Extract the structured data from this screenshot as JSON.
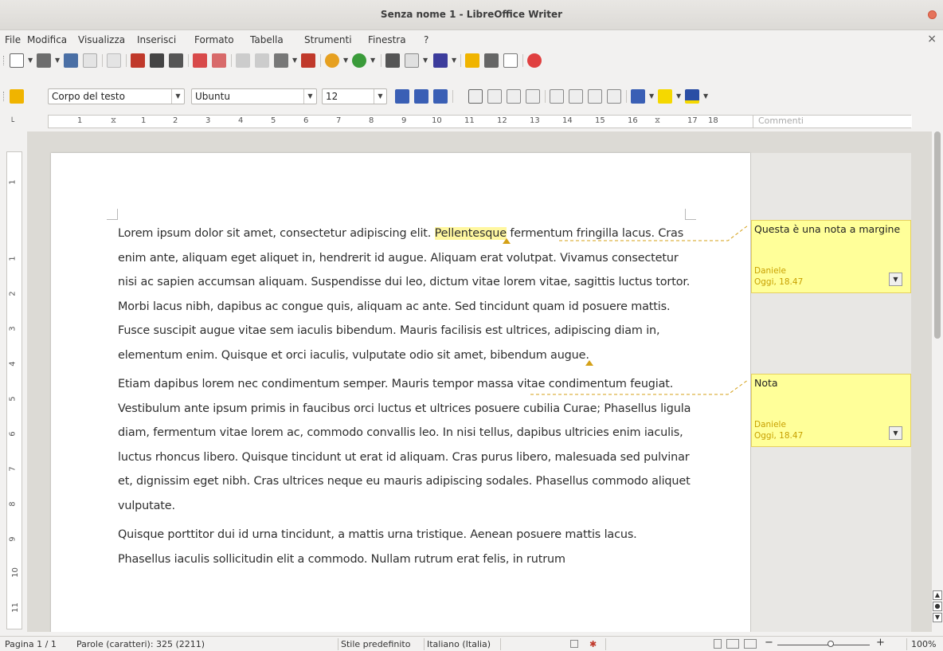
{
  "window": {
    "title": "Senza nome 1 - LibreOffice Writer"
  },
  "menu": {
    "items": [
      "File",
      "Modifica",
      "Visualizza",
      "Inserisci",
      "Formato",
      "Tabella",
      "Strumenti",
      "Finestra",
      "?"
    ],
    "close_glyph": "×"
  },
  "formatting": {
    "paragraph_style": "Corpo del testo",
    "font_name": "Ubuntu",
    "font_size": "12"
  },
  "ruler": {
    "numbers": [
      "1",
      "1",
      "2",
      "3",
      "4",
      "5",
      "6",
      "7",
      "8",
      "9",
      "10",
      "11",
      "12",
      "13",
      "14",
      "15",
      "16",
      "17",
      "18"
    ],
    "comments_label": "Commenti",
    "vertical_numbers": [
      "1",
      "1",
      "2",
      "3",
      "4",
      "5",
      "6",
      "7",
      "8",
      "9",
      "10",
      "11"
    ]
  },
  "document": {
    "p1_a": "Lorem ipsum dolor sit amet, consectetur adipiscing elit. ",
    "p1_highlight": "Pellentesque",
    "p1_b": " fermentum fringilla lacus. Cras enim ante, aliquam eget aliquet in, hendrerit id augue. Aliquam erat volutpat. Vivamus consectetur nisi ac sapien accumsan aliquam. Suspendisse dui leo, dictum vitae lorem vitae, sagittis luctus tortor. Morbi lacus nibh, dapibus ac congue quis, aliquam ac ante. Sed tincidunt quam id posuere mattis. Fusce suscipit augue vitae sem iaculis bibendum. Mauris facilisis est ultrices, adipiscing diam in, elementum enim. Quisque et orci iaculis, vulputate odio sit amet, bibendum augue.",
    "p2": "Etiam dapibus lorem nec condimentum semper. Mauris tempor massa vitae condimentum feugiat. Vestibulum ante ipsum primis in faucibus orci luctus et ultrices posuere cubilia Curae; Phasellus ligula diam, fermentum vitae lorem ac, commodo convallis leo. In nisi tellus, dapibus ultricies enim iaculis, luctus rhoncus libero. Quisque tincidunt ut erat id aliquam. Cras purus libero, malesuada sed pulvinar et, dignissim eget nibh. Cras ultrices neque eu mauris adipiscing sodales. Phasellus commodo aliquet vulputate.",
    "p3": "Quisque porttitor dui id urna tincidunt, a mattis urna tristique. Aenean posuere mattis lacus. Phasellus iaculis sollicitudin elit a commodo. Nullam rutrum erat felis, in rutrum"
  },
  "comments": [
    {
      "text": "Questa è una nota a margine",
      "author": "Daniele",
      "date": "Oggi, 18.47"
    },
    {
      "text": "Nota",
      "author": "Daniele",
      "date": "Oggi, 18.47"
    }
  ],
  "status": {
    "page": "Pagina 1 / 1",
    "words": "Parole (caratteri): 325 (2211)",
    "page_style": "Stile predefinito",
    "language": "Italiano (Italia)",
    "zoom_minus": "−",
    "zoom_plus": "+",
    "zoom": "100%"
  },
  "colors": {
    "note_bg": "#ffff99",
    "note_meta": "#c8a000",
    "highlight": "#fff7a0",
    "anchor": "#d4a017"
  }
}
